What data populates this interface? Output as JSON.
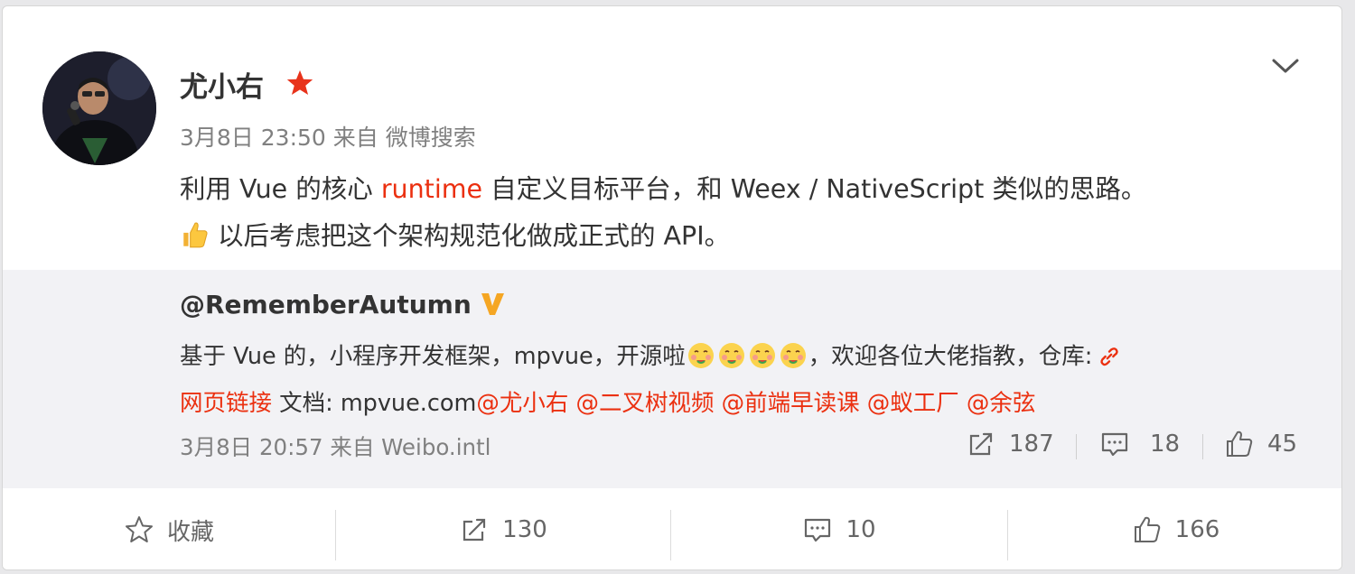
{
  "post": {
    "author": "尤小右",
    "meta": "3月8日 23:50 来自 微博搜索",
    "text_line1_a": "利用 Vue 的核心 ",
    "text_line1_link": "runtime",
    "text_line1_b": " 自定义目标平台，和 Weex / NativeScript 类似的思路。",
    "text_line2": "以后考虑把这个架构规范化做成正式的 API。"
  },
  "repost": {
    "user": "@RememberAutumn",
    "text_a": "基于 Vue 的，小程序开发框架，mpvue，开源啦",
    "text_b": "，欢迎各位大佬指教，仓库:",
    "link_label": "网页链接",
    "docs_text": "  文档: mpvue.com",
    "mentions": [
      "@尤小右",
      "@二叉树视频",
      "@前端早读课",
      "@蚁工厂",
      "@余弦"
    ],
    "meta": "3月8日 20:57 来自 Weibo.intl",
    "stats": {
      "reposts": "187",
      "comments": "18",
      "likes": "45"
    }
  },
  "actions": {
    "favorite": "收藏",
    "reposts": "130",
    "comments": "10",
    "likes": "166"
  },
  "colors": {
    "accent": "#eb3010",
    "verified": "#f5a623",
    "text": "#333333",
    "muted": "#808080",
    "repost_bg": "#f2f2f5"
  },
  "icons": [
    "star-badge-icon",
    "chevron-down-icon",
    "thumbs-up-emoji-icon",
    "verified-v-icon",
    "yummy-emoji-icon",
    "link-icon",
    "repost-icon",
    "comment-icon",
    "like-icon",
    "favorite-star-icon"
  ]
}
